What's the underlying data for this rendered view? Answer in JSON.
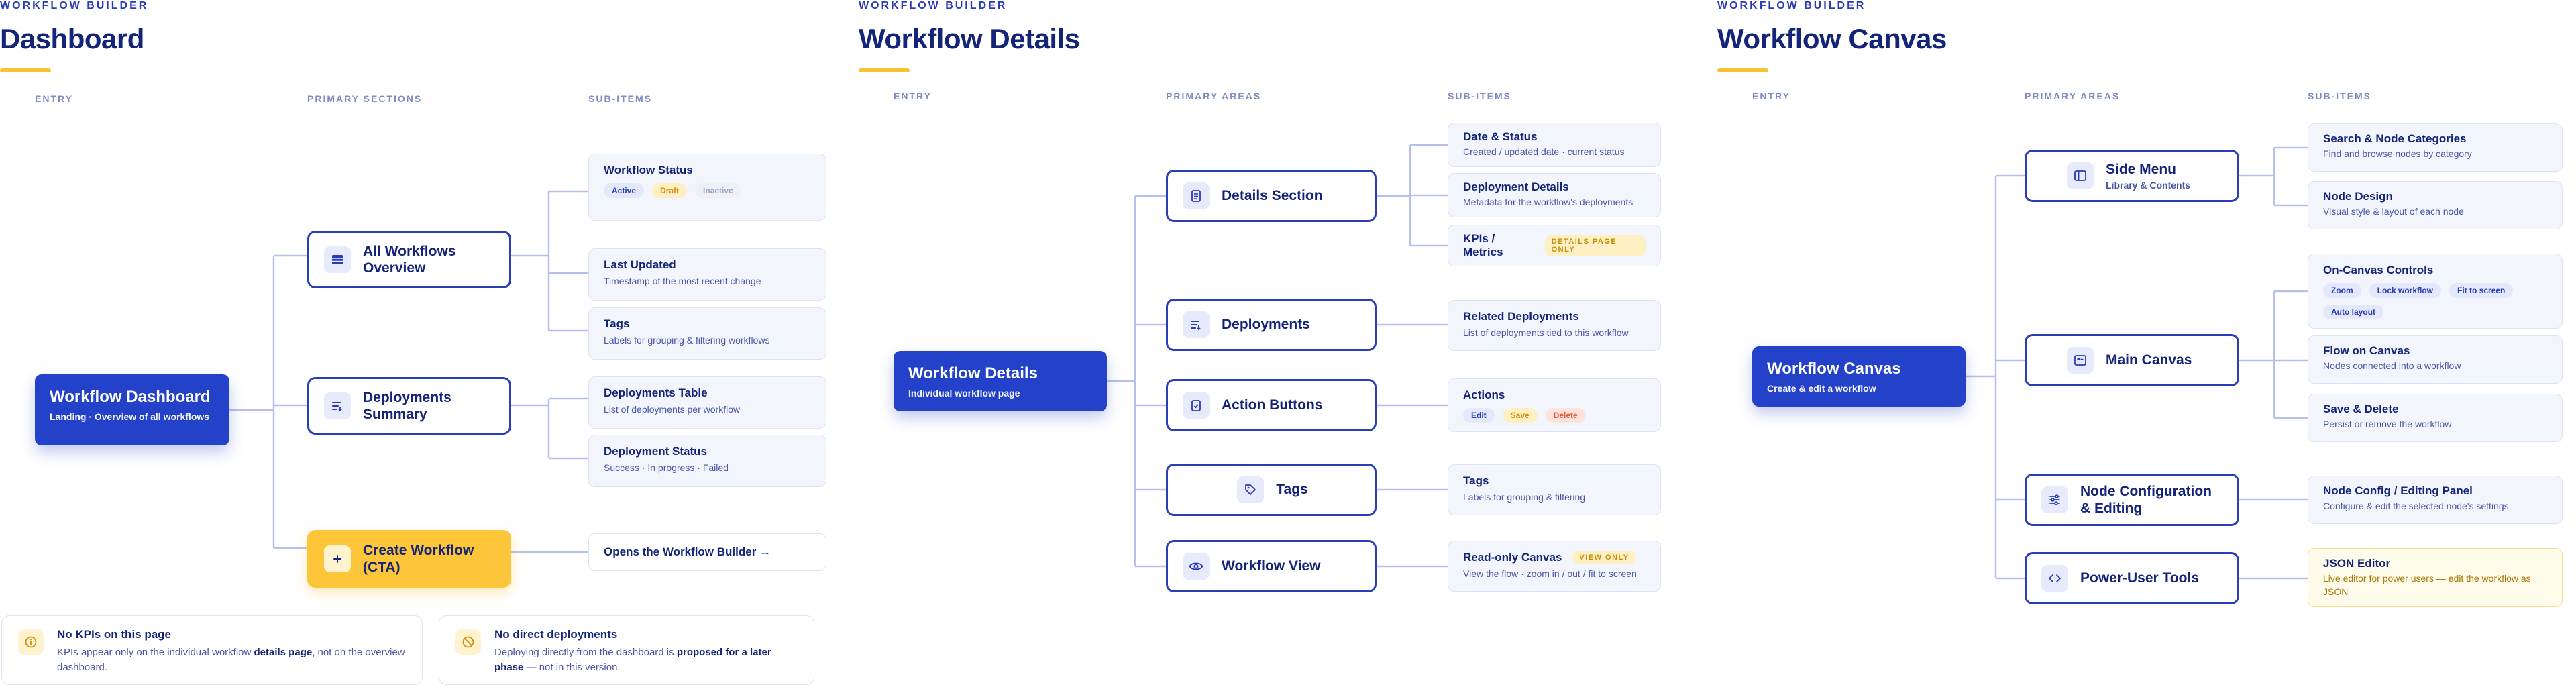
{
  "panels": [
    {
      "eyebrow": "WORKFLOW BUILDER",
      "title": "Dashboard",
      "columns": [
        "ENTRY",
        "PRIMARY SECTIONS",
        "SUB-ITEMS"
      ],
      "root": {
        "title": "Workflow Dashboard",
        "subtitle": "Landing · Overview of all workflows"
      },
      "sections": [
        {
          "title": "All Workflows Overview",
          "icon": "table-icon"
        },
        {
          "title": "Deployments Summary",
          "icon": "list-icon"
        },
        {
          "title": "Create Workflow (CTA)",
          "icon": "plus-icon"
        }
      ],
      "leaves": [
        {
          "title": "Workflow Status",
          "chips": [
            "Active",
            "Draft",
            "Inactive"
          ]
        },
        {
          "title": "Last Updated",
          "subtitle": "Timestamp of the most recent change"
        },
        {
          "title": "Tags",
          "subtitle": "Labels for grouping & filtering workflows"
        },
        {
          "title": "Deployments Table",
          "subtitle": "List of deployments per workflow"
        },
        {
          "title": "Deployment Status",
          "subtitle": "Success · In progress · Failed"
        },
        {
          "title": "Opens the Workflow Builder →"
        }
      ],
      "notes": [
        {
          "title": "No KPIs on this page",
          "text_a": "KPIs appear only on the individual workflow ",
          "bold": "details page",
          "text_b": ", not on the overview dashboard.",
          "icon": "info-icon"
        },
        {
          "title": "No direct deployments",
          "text_a": "Deploying directly from the dashboard is ",
          "bold": "proposed for a later phase",
          "text_b": " — not in this version.",
          "icon": "prohibited-icon"
        }
      ]
    },
    {
      "eyebrow": "WORKFLOW BUILDER",
      "title": "Workflow Details",
      "columns": [
        "ENTRY",
        "PRIMARY AREAS",
        "SUB-ITEMS"
      ],
      "root": {
        "title": "Workflow Details",
        "subtitle": "Individual workflow page"
      },
      "sections": [
        {
          "title": "Details Section",
          "icon": "document-icon"
        },
        {
          "title": "Deployments",
          "icon": "list-icon"
        },
        {
          "title": "Action Buttons",
          "icon": "clipboard-icon"
        },
        {
          "title": "Tags",
          "icon": "tag-icon"
        },
        {
          "title": "Workflow View",
          "icon": "eye-icon"
        }
      ],
      "leaves": [
        {
          "title": "Date & Status",
          "subtitle": "Created / updated date · current status"
        },
        {
          "title": "Deployment Details",
          "subtitle": "Metadata for the workflow's deployments"
        },
        {
          "title": "KPIs / Metrics",
          "badge": "DETAILS PAGE ONLY"
        },
        {
          "title": "Related Deployments",
          "subtitle": "List of deployments tied to this workflow"
        },
        {
          "title": "Actions",
          "chips": [
            "Edit",
            "Save",
            "Delete"
          ]
        },
        {
          "title": "Tags",
          "subtitle": "Labels for grouping & filtering"
        },
        {
          "title": "Read-only Canvas",
          "badge": "VIEW ONLY",
          "subtitle": "View the flow · zoom in / out / fit to screen"
        }
      ]
    },
    {
      "eyebrow": "WORKFLOW BUILDER",
      "title": "Workflow Canvas",
      "columns": [
        "ENTRY",
        "PRIMARY AREAS",
        "SUB-ITEMS"
      ],
      "root": {
        "title": "Workflow Canvas",
        "subtitle": "Create & edit a workflow"
      },
      "sections": [
        {
          "title": "Side Menu",
          "subtitle": "Library & Contents",
          "icon": "sidebar-icon"
        },
        {
          "title": "Main Canvas",
          "icon": "canvas-icon"
        },
        {
          "title": "Node Configuration & Editing",
          "icon": "sliders-icon"
        },
        {
          "title": "Power-User Tools",
          "icon": "code-icon"
        }
      ],
      "leaves": [
        {
          "title": "Search & Node Categories",
          "subtitle": "Find and browse nodes by category"
        },
        {
          "title": "Node Design",
          "subtitle": "Visual style & layout of each node"
        },
        {
          "title": "On-Canvas Controls",
          "chips": [
            "Zoom",
            "Lock workflow",
            "Fit to screen",
            "Auto layout"
          ]
        },
        {
          "title": "Flow on Canvas",
          "subtitle": "Nodes connected into a workflow"
        },
        {
          "title": "Save & Delete",
          "subtitle": "Persist or remove the workflow"
        },
        {
          "title": "Node Config / Editing Panel",
          "subtitle": "Configure & edit the selected node's settings"
        },
        {
          "title": "JSON Editor",
          "subtitle": "Live editor for power users — edit the workflow as JSON"
        }
      ]
    }
  ]
}
